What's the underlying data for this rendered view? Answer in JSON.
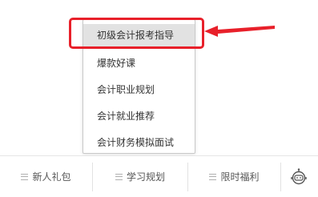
{
  "popup_menu": {
    "items": [
      {
        "label": "初级会计报考指导",
        "active": true
      },
      {
        "label": "爆款好课"
      },
      {
        "label": "会计职业规划"
      },
      {
        "label": "会计就业推荐"
      },
      {
        "label": "会计财务模拟面试"
      }
    ]
  },
  "annotation": {
    "highlight_color": "#e8202a"
  },
  "bottom_nav": {
    "items": [
      {
        "label": "新人礼包",
        "icon": "menu-icon"
      },
      {
        "label": "学习规划",
        "icon": "menu-icon"
      },
      {
        "label": "限时福利",
        "icon": "menu-icon"
      }
    ],
    "robot_icon": "robot-icon"
  }
}
